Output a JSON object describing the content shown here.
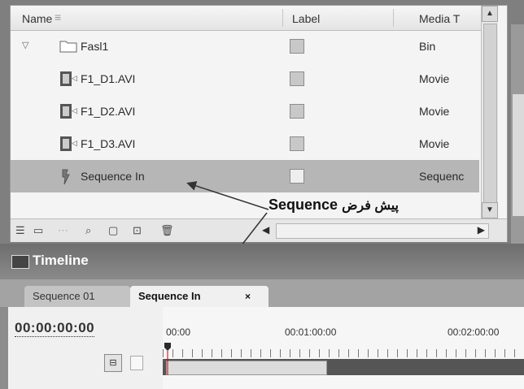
{
  "project_panel": {
    "columns": {
      "name": "Name",
      "label": "Label",
      "media_type": "Media T"
    },
    "rows": [
      {
        "name": "Fasl1",
        "type": "Bin",
        "icon": "folder-icon"
      },
      {
        "name": "F1_D1.AVI",
        "type": "Movie",
        "icon": "movie-icon"
      },
      {
        "name": "F1_D2.AVI",
        "type": "Movie",
        "icon": "movie-icon"
      },
      {
        "name": "F1_D3.AVI",
        "type": "Movie",
        "icon": "movie-icon"
      },
      {
        "name": "Sequence In",
        "type": "Sequenc",
        "icon": "sequence-icon",
        "selected": true
      }
    ]
  },
  "annotation": {
    "text": "Sequence",
    "sub": "پیش فرض"
  },
  "timeline": {
    "title": "Timeline",
    "tabs": [
      {
        "label": "Sequence 01",
        "active": false
      },
      {
        "label": "Sequence In",
        "active": true,
        "close": "×"
      }
    ],
    "timecode": "00:00:00:00",
    "ruler": [
      "00:00",
      "00:01:00:00",
      "00:02:00:00"
    ]
  }
}
